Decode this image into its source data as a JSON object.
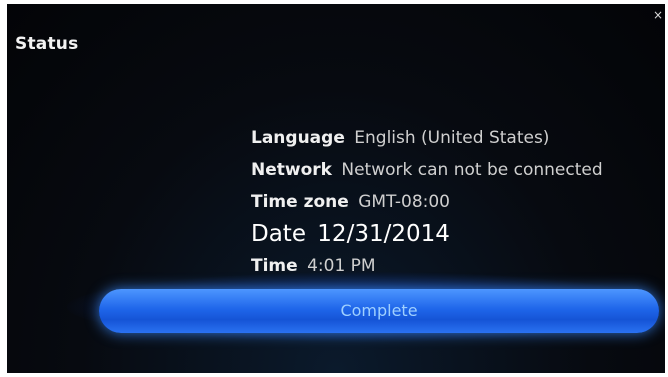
{
  "dialog": {
    "title": "Status",
    "close_glyph": "×"
  },
  "status": {
    "language_label": "Language",
    "language_value": "English (United States)",
    "network_label": "Network",
    "network_value": "Network can not be connected",
    "timezone_label": "Time zone",
    "timezone_value": "GMT-08:00",
    "date_label": "Date",
    "date_value": "12/31/2014",
    "time_label": "Time",
    "time_value": "4:01 PM"
  },
  "actions": {
    "confirm_label": "Complete"
  },
  "colors": {
    "background": "#05070b",
    "button_accent": "#1f66ea",
    "button_text": "#9fd0ff"
  }
}
